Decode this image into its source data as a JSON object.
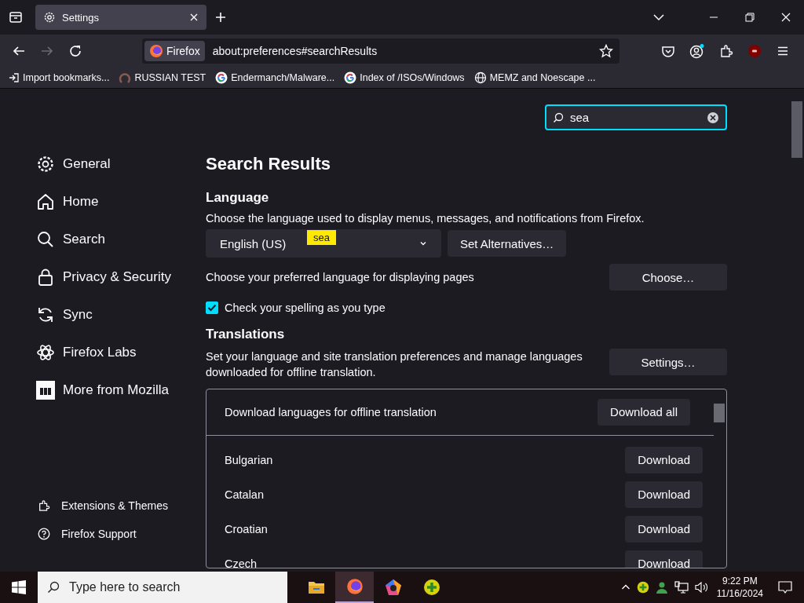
{
  "tabs": [
    {
      "title": "Settings",
      "selected": true
    }
  ],
  "toolbar": {
    "identity": "Firefox",
    "url": "about:preferences#searchResults"
  },
  "bookmarks": [
    {
      "label": "Import bookmarks...",
      "kind": "import"
    },
    {
      "label": "RUSSIAN TEST",
      "kind": "loop"
    },
    {
      "label": "Endermanch/Malware...",
      "kind": "google"
    },
    {
      "label": "Index of /ISOs/Windows",
      "kind": "google"
    },
    {
      "label": "MEMZ and Noescape ...",
      "kind": "globe"
    }
  ],
  "search": {
    "value": "sea",
    "highlight": "sea"
  },
  "sidebar": {
    "items": [
      {
        "label": "General",
        "kind": "gear",
        "selected": false
      },
      {
        "label": "Home",
        "kind": "home",
        "selected": false
      },
      {
        "label": "Search",
        "kind": "search",
        "selected": false
      },
      {
        "label": "Privacy & Security",
        "kind": "lock",
        "selected": false
      },
      {
        "label": "Sync",
        "kind": "sync",
        "selected": false
      },
      {
        "label": "Firefox Labs",
        "kind": "flask",
        "selected": false
      },
      {
        "label": "More from Mozilla",
        "kind": "square",
        "selected": false
      }
    ],
    "footer": [
      {
        "label": "Extensions & Themes",
        "kind": "puzzle"
      },
      {
        "label": "Firefox Support",
        "kind": "help"
      }
    ]
  },
  "heading": "Search Results",
  "language": {
    "title": "Language",
    "description": "Choose the language used to display menus, messages, and notifications from Firefox.",
    "dropdown": "English (US)",
    "alternatives_button": "Set Alternatives…",
    "pages_label": "Choose your preferred language for displaying pages",
    "choose_button": "Choose…",
    "spellcheck": {
      "label": "Check your spelling as you type",
      "checked": true
    }
  },
  "translations": {
    "title": "Translations",
    "description": "Set your language and site translation preferences and manage languages downloaded for offline translation.",
    "settings_button": "Settings…",
    "list_header": "Download languages for offline translation",
    "download_all": "Download all",
    "languages": [
      {
        "name": "Bulgarian",
        "button": "Download"
      },
      {
        "name": "Catalan",
        "button": "Download"
      },
      {
        "name": "Croatian",
        "button": "Download"
      },
      {
        "name": "Czech",
        "button": "Download"
      }
    ]
  },
  "taskbar": {
    "search_placeholder": "Type here to search",
    "apps": [
      {
        "kind": "folder",
        "selected": false
      },
      {
        "kind": "firefox",
        "selected": true
      },
      {
        "kind": "pentagon",
        "selected": false
      },
      {
        "kind": "plus",
        "selected": false
      }
    ],
    "time": "9:22 PM",
    "date": "11/16/2024"
  }
}
